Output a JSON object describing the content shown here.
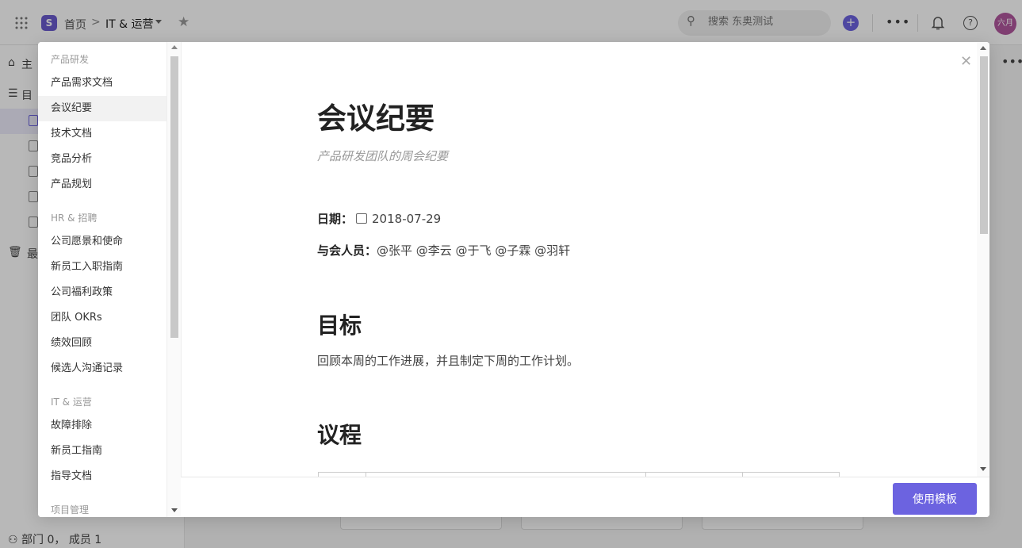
{
  "topbar": {
    "home": "首页",
    "separator": ">",
    "current_space": "IT & 运营",
    "search_placeholder": "搜索 东奥测试",
    "plus": "+",
    "more": "•••",
    "help": "?",
    "avatar_label": "六月"
  },
  "sidebar": {
    "row1": "主",
    "row2": "目",
    "row3": "最",
    "footer": "部门 0， 成员 1"
  },
  "template_list": {
    "groups": [
      {
        "title": "产品研发",
        "items": [
          "产品需求文档",
          "会议纪要",
          "技术文档",
          "竞品分析",
          "产品规划"
        ]
      },
      {
        "title": "HR & 招聘",
        "items": [
          "公司愿景和使命",
          "新员工入职指南",
          "公司福利政策",
          "团队 OKRs",
          "绩效回顾",
          "候选人沟通记录"
        ]
      },
      {
        "title": "IT & 运营",
        "items": [
          "故障排除",
          "新员工指南",
          "指导文档"
        ]
      },
      {
        "title": "项目管理",
        "items": []
      }
    ],
    "selected": "会议纪要"
  },
  "preview": {
    "title": "会议纪要",
    "subtitle": "产品研发团队的周会纪要",
    "date_label": "日期：",
    "date_value": "2018-07-29",
    "attendees_label": "与会人员：",
    "attendees_value": "@张平 @李云 @于飞 @子霖 @羽轩",
    "goal_heading": "目标",
    "goal_text": "回顾本周的工作进展，并且制定下周的工作计划。",
    "agenda_heading": "议程"
  },
  "footer": {
    "use_template": "使用模板"
  },
  "colors": {
    "accent": "#6c63e0",
    "avatar": "#b0579d"
  }
}
